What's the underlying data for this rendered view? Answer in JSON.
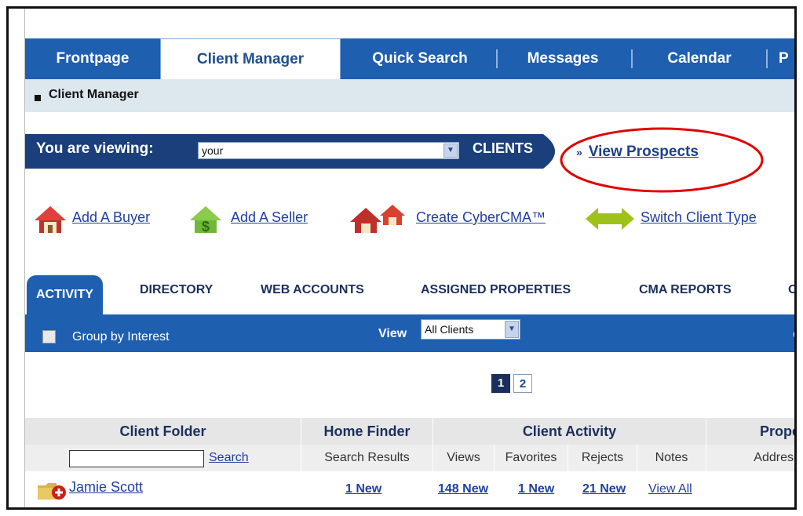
{
  "nav": {
    "tabs": [
      "Frontpage",
      "Client Manager",
      "Quick Search",
      "Messages",
      "Calendar",
      "P"
    ],
    "active": "Client Manager"
  },
  "breadcrumb": "Client Manager",
  "viewing": {
    "label": "You are viewing:",
    "selected": "your",
    "suffix": "CLIENTS"
  },
  "prospects": {
    "arrows": "»",
    "label": "View Prospects"
  },
  "actions": [
    "Add A Buyer",
    "Add A Seller",
    "Create CyberCMA™",
    "Switch Client Type"
  ],
  "tabs": [
    "ACTIVITY",
    "DIRECTORY",
    "WEB ACCOUNTS",
    "ASSIGNED PROPERTIES",
    "CMA REPORTS",
    "O"
  ],
  "filter": {
    "group_label": "Group by Interest",
    "view_label": "View",
    "view_selected": "All Clients",
    "right_text": "C"
  },
  "pager": [
    "1",
    "2"
  ],
  "table": {
    "headers": [
      "Client Folder",
      "Home Finder",
      "Client Activity",
      "Prope"
    ],
    "search_link": "Search",
    "subheaders": [
      "Search Results",
      "Views",
      "Favorites",
      "Rejects",
      "Notes",
      "Address"
    ],
    "row": {
      "name": "Jamie Scott",
      "home_finder": "1 New",
      "views": "148 New",
      "favorites": "1 New",
      "rejects": "21 New",
      "notes": "View All"
    }
  },
  "colors": {
    "nav_blue": "#1f5fb0",
    "dark_navy": "#1a2f5c",
    "link_blue": "#1f3fa0",
    "highlight_red": "#e00000"
  }
}
